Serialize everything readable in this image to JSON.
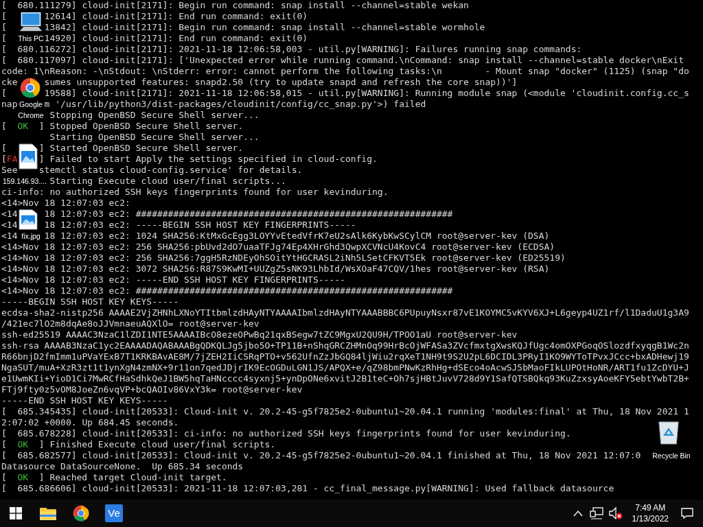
{
  "console": {
    "lines": [
      {
        "kind": "plain",
        "segments": [
          "[  680.111279] cloud-init[2171]: Begin run command: snap install --channel=stable wekan"
        ]
      },
      {
        "kind": "plain",
        "segments": [
          "[",
          "12614] cloud-init[2171]: End run command: exit(0)"
        ]
      },
      {
        "kind": "plain",
        "segments": [
          "[",
          "13842] cloud-init[2171]: Begin run command: snap install --channel=stable wormhole"
        ]
      },
      {
        "kind": "plain",
        "segments": [
          "[",
          "14920] cloud-init[2171]: End run command: exit(0)"
        ]
      },
      {
        "kind": "plain",
        "segments": [
          "[  680.116272] cloud-init[2171]: 2021-11-18 12:06:58,003 - util.py[WARNING]: Failures running snap commands:"
        ]
      },
      {
        "kind": "plain",
        "segments": [
          "[  680.117097] cloud-init[2171]: ['Unexpected error while running command.\\nCommand: snap install --channel=stable docker\\nExit"
        ]
      },
      {
        "kind": "plain",
        "segments": [
          "code: 1\\nReason: -\\nStdout: \\nStderr: error: cannot perform the following tasks:\\n        - Mount snap \"docker\" (1125) (snap \"do"
        ]
      },
      {
        "kind": "plain",
        "segments": [
          "cke",
          "sumes unsupported features: snapd2.50 (try to update snapd and refresh the core snap))']"
        ]
      },
      {
        "kind": "plain",
        "segments": [
          "[",
          "19588] cloud-init[2171]: 2021-11-18 12:06:58,015 - util.py[WARNING]: Running module snap (<module 'cloudinit.config.cc_s"
        ]
      },
      {
        "kind": "plain",
        "segments": [
          "nap",
          "m '/usr/lib/python3/dist-packages/cloudinit/config/cc_snap.py'>) failed"
        ]
      },
      {
        "kind": "plain",
        "segments": [
          "Stopping OpenBSD Secure Shell server..."
        ]
      },
      {
        "kind": "ok",
        "open": "[",
        "status": "OK",
        "close": "]",
        "text": "Stopped OpenBSD Secure Shell server."
      },
      {
        "kind": "plain",
        "segments": [
          "Starting OpenBSD Secure Shell server..."
        ]
      },
      {
        "kind": "ok",
        "open": "[",
        "close": "]",
        "text": "Started OpenBSD Secure Shell server."
      },
      {
        "kind": "failed",
        "open": "[",
        "status": "FA",
        "close": "]",
        "text": "Failed to start Apply the settings specified in cloud-config."
      },
      {
        "kind": "plain",
        "segments": [
          "See",
          "stemctl status cloud-config.service' for details."
        ]
      },
      {
        "kind": "plain",
        "segments": [
          "Starting Execute cloud user/final scripts..."
        ]
      },
      {
        "kind": "plain",
        "segments": [
          "ci-info: no authorized SSH keys fingerprints found for user kevinduring."
        ]
      },
      {
        "kind": "plain",
        "segments": [
          "<14>Nov 18 12:07:03 ec2:"
        ]
      },
      {
        "kind": "plain",
        "segments": [
          "<14",
          "18 12:07:03 ec2: ###########################################################"
        ]
      },
      {
        "kind": "plain",
        "segments": [
          "<14",
          "18 12:07:03 ec2: -----BEGIN SSH HOST KEY FINGERPRINTS-----"
        ]
      },
      {
        "kind": "plain",
        "segments": [
          "<14",
          "18 12:07:03 ec2: 1024 SHA256:KtMxGcEgg3LOYYvEtedVfrK7eU2sAlk6KybKwSCylCM root@server-kev (DSA)"
        ]
      },
      {
        "kind": "plain",
        "segments": [
          "<14>Nov 18 12:07:03 ec2: 256 SHA256:pbUvd2dO7uaaTFJg74Ep4XHrGhd3QwpXCVNcU4KovC4 root@server-kev (ECDSA)"
        ]
      },
      {
        "kind": "plain",
        "segments": [
          "<14>Nov 18 12:07:03 ec2: 256 SHA256:7ggH5RzNDEyOhSOitYtHGCRASL2iNh5LSetCFKVT5Ek root@server-kev (ED25519)"
        ]
      },
      {
        "kind": "plain",
        "segments": [
          "<14>Nov 18 12:07:03 ec2: 3072 SHA256:R87S9KwMI+UUZgZ5sNK93LhbId/WsXOaF47CQV/1hes root@server-kev (RSA)"
        ]
      },
      {
        "kind": "plain",
        "segments": [
          "<14>Nov 18 12:07:03 ec2: -----END SSH HOST KEY FINGERPRINTS-----"
        ]
      },
      {
        "kind": "plain",
        "segments": [
          "<14>Nov 18 12:07:03 ec2: ###########################################################"
        ]
      },
      {
        "kind": "plain",
        "segments": [
          "-----BEGIN SSH HOST KEY KEYS-----"
        ]
      },
      {
        "kind": "plain",
        "segments": [
          "ecdsa-sha2-nistp256 AAAAE2VjZHNhLXNoYTItbmlzdHAyNTYAAAAIbmlzdHAyNTYAAABBBC6PUpuyNsxr87vE1KOYMC5vKYV6XJ+L6geyp4UZ1rf/l1DaduU1g3A9"
        ]
      },
      {
        "kind": "plain",
        "segments": [
          "/421ec7lO2m8dqAe8oJJVmnaeuAQXlO= root@server-kev"
        ]
      },
      {
        "kind": "plain",
        "segments": [
          "ssh-ed25519 AAAAC3NzaC1lZDI1NTE5AAAAIBcO8ezeOPwBq21qxBSegw7tZC9MgxU2QU9H/TPOO1aU root@server-kev"
        ]
      },
      {
        "kind": "plain",
        "segments": [
          "ssh-rsa AAAAB3NzaC1yc2EAAAADAQABAAABgQDKQLJg5jbo5O+TP11B+nShqGRCZHMnOq99HrBcOjWFASa3ZVcfmxtgXwsKQJfUgc4omOXPGoqOSlozdfxyqgB1Wc2n"
        ]
      },
      {
        "kind": "plain",
        "segments": [
          "R66bnjD2fmImm1uPVaYExB7T1KRKBAvAE8M/7jZEH2IiCSRqPTO+v562UfnZzJbGQ84ljWiu2rqXeT1NH9t9S2U2pL6DCIDL3PRyI1KO9WYToTPvxJCcc+bxADHewj19"
        ]
      },
      {
        "kind": "plain",
        "segments": [
          "NgaSUT/muA+XzR3zt1t1ynXgN4zmNX+9r11on7qedJDjrIK9EcOGDuLGN1JS/APQX+e/qZ98bmPNwKzRhHg+dSEco4oAcwSJ5bMaoFIkLUPOtHoNR/ART1fu1ZcDYU+J"
        ]
      },
      {
        "kind": "plain",
        "segments": [
          "e1UwmKIi+YioD1Ci7MwRCfHaSdhkQeJ1BW5hqTaHNcccc4syxnj5+ynDpONe6xvitJ2B1teC+Oh7sjHBtJuvV728d9Y1SafQTSBQkq93KuZzxsyAoeKFY5ebtYwbT2B+"
        ]
      },
      {
        "kind": "plain",
        "segments": [
          "FTj9fty0z5vOM8JoeZn6vqVP+bcQAOIv86VxY3k= root@server-kev"
        ]
      },
      {
        "kind": "plain",
        "segments": [
          "-----END SSH HOST KEY KEYS-----"
        ]
      },
      {
        "kind": "plain",
        "segments": [
          "[  685.345435] cloud-init[20533]: Cloud-init v. 20.2-45-g5f7825e2-0ubuntu1~20.04.1 running 'modules:final' at Thu, 18 Nov 2021 1"
        ]
      },
      {
        "kind": "plain",
        "segments": [
          "2:07:02 +0000. Up 684.45 seconds."
        ]
      },
      {
        "kind": "plain",
        "segments": [
          "[  685.678228] cloud-init[20533]: ci-info: no authorized SSH keys fingerprints found for user kevinduring."
        ]
      },
      {
        "kind": "ok",
        "open": "[",
        "status": "OK",
        "close": "]",
        "text": "Finished Execute cloud user/final scripts."
      },
      {
        "kind": "plain",
        "segments": [
          "[  685.682577] cloud-init[20533]: Cloud-init v. 20.2-45-g5f7825e2-0ubuntu1~20.04.1 finished at Thu, 18 Nov 2021 12:07:0"
        ]
      },
      {
        "kind": "plain",
        "segments": [
          "Datasource DataSourceNone.  Up 685.34 seconds"
        ]
      },
      {
        "kind": "ok",
        "open": "[",
        "status": "OK",
        "close": "]",
        "text": "Reached target Cloud-init target."
      },
      {
        "kind": "plain",
        "segments": [
          "[  685.686606] cloud-init[20533]: 2021-11-18 12:07:03,281 - cc_final_message.py[WARNING]: Used fallback datasource"
        ]
      }
    ]
  },
  "desktop_icons": [
    {
      "kind": "computer",
      "label": "This PC"
    },
    {
      "kind": "chrome",
      "label": "Google Chrome"
    },
    {
      "kind": "image",
      "label": "159.146.93...."
    },
    {
      "kind": "image",
      "label": "fix.jpg"
    },
    {
      "kind": "recycle",
      "label": "Recycle Bin"
    }
  ],
  "taskbar": {
    "apps": [
      {
        "kind": "start"
      },
      {
        "kind": "explorer"
      },
      {
        "kind": "chrome"
      },
      {
        "kind": "ve",
        "label": "Ve"
      }
    ],
    "tray": {
      "time": "7:49 AM",
      "date": "1/13/2022",
      "muted": true
    }
  }
}
